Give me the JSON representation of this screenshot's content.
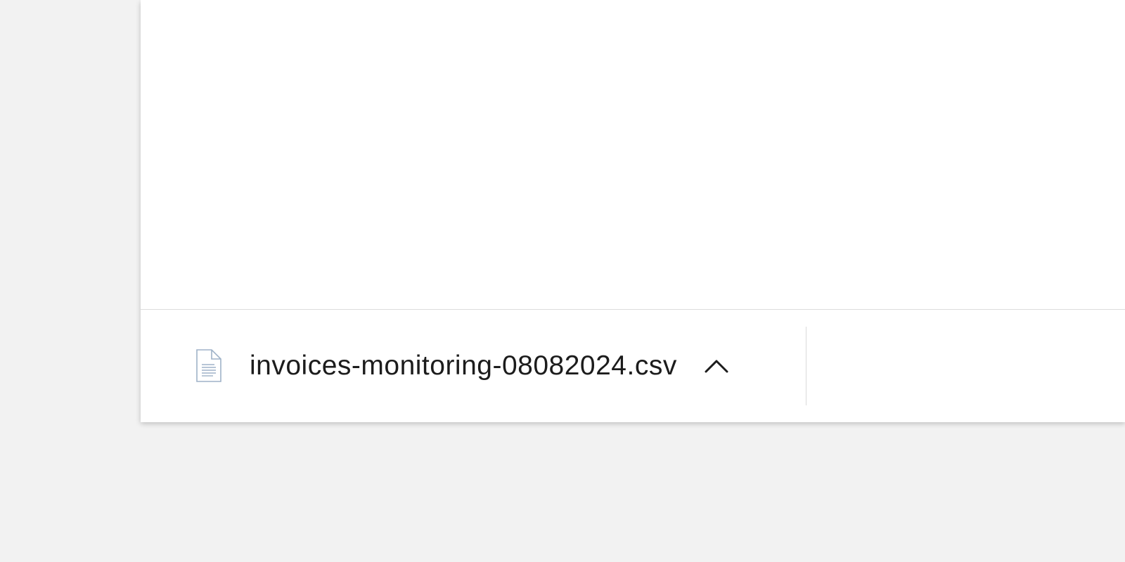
{
  "download_shelf": {
    "file_name": "invoices-monitoring-08082024.csv",
    "file_icon": "document-icon",
    "menu_icon": "chevron-up-icon"
  },
  "colors": {
    "page_background": "#f2f2f2",
    "window_background": "#ffffff",
    "text": "#1c1c1c",
    "icon_outline": "#9fb2c8"
  }
}
